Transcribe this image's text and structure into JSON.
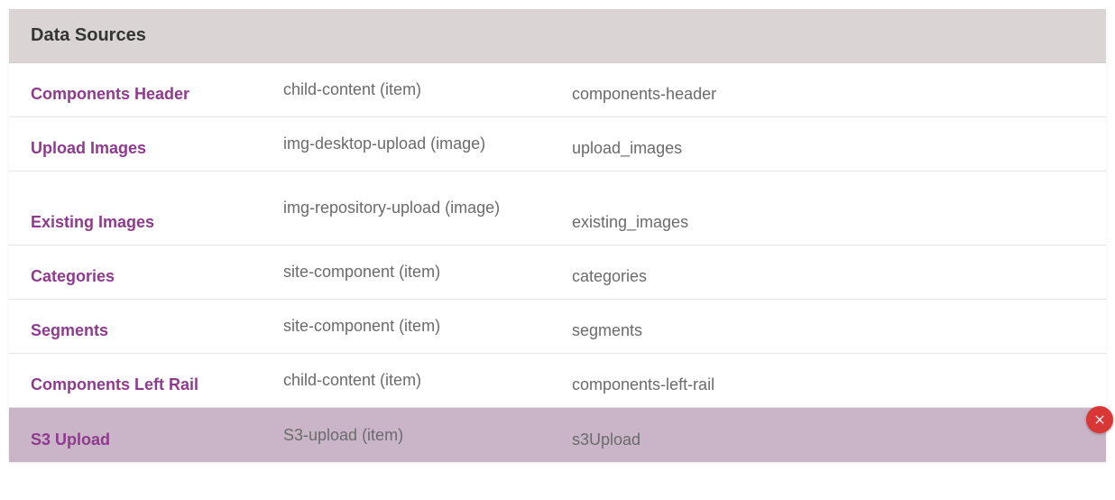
{
  "header": {
    "title": "Data Sources"
  },
  "rows": [
    {
      "name": "Components Header",
      "type": "child-content (item)",
      "id": "components-header",
      "selected": false,
      "tall": false
    },
    {
      "name": "Upload Images",
      "type": "img-desktop-upload (image)",
      "id": "upload_images",
      "selected": false,
      "tall": false
    },
    {
      "name": "Existing Images",
      "type": "img-repository-upload (image)",
      "id": "existing_images",
      "selected": false,
      "tall": true
    },
    {
      "name": "Categories",
      "type": "site-component (item)",
      "id": "categories",
      "selected": false,
      "tall": false
    },
    {
      "name": "Segments",
      "type": "site-component (item)",
      "id": "segments",
      "selected": false,
      "tall": false
    },
    {
      "name": "Components Left Rail",
      "type": "child-content (item)",
      "id": "components-left-rail",
      "selected": false,
      "tall": false
    },
    {
      "name": "S3 Upload",
      "type": "S3-upload (item)",
      "id": "s3Upload",
      "selected": true,
      "tall": false
    }
  ]
}
